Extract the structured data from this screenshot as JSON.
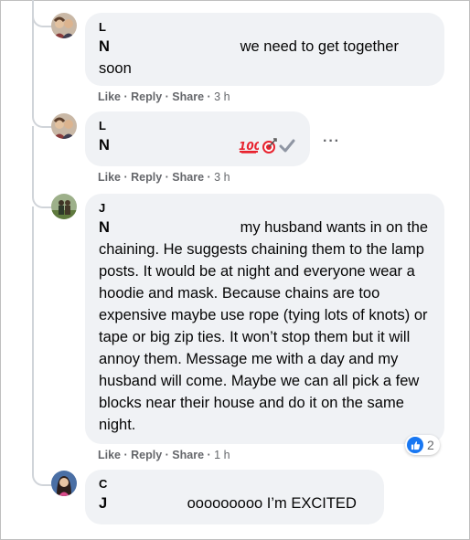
{
  "comments": [
    {
      "author": "L",
      "mention": "N",
      "text": "we need to get together soon",
      "actions": {
        "like": "Like",
        "reply": "Reply",
        "share": "Share",
        "time": "3 h"
      }
    },
    {
      "author": "L",
      "mention": "N",
      "emojis": [
        "hundred-points-icon",
        "bullseye-icon",
        "check-mark-icon"
      ],
      "more_label": "···",
      "actions": {
        "like": "Like",
        "reply": "Reply",
        "share": "Share",
        "time": "3 h"
      }
    },
    {
      "author": "J",
      "mention": "N",
      "text_first": "my husband wants in on",
      "text_rest": "the chaining. He suggests chaining them to the lamp posts. It would be at night and everyone wear a hoodie and mask. Because chains are too expensive maybe use rope (tying lots of knots) or tape or big zip ties. It won’t stop them but it will annoy them. Message me with a day and my husband will come. Maybe we can all pick a few blocks near their house and do it on the same night.",
      "reaction_icon": "like-icon",
      "reaction_count": "2",
      "actions": {
        "like": "Like",
        "reply": "Reply",
        "share": "Share",
        "time": "1 h"
      }
    },
    {
      "author": "C",
      "mention": "J",
      "text": "ooooooooo I’m EXCITED"
    }
  ],
  "separator": " · ",
  "colors": {
    "bubble": "#f0f2f5",
    "meta": "#65676b",
    "like_blue": "#1877f2"
  }
}
